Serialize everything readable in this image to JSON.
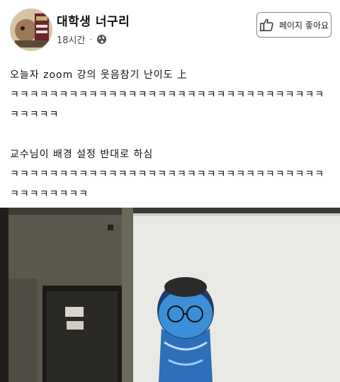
{
  "header": {
    "page_name": "대학생 너구리",
    "time": "18시간",
    "separator": "·",
    "like_page_label": "페이지 좋아요"
  },
  "post": {
    "line1": "오늘자 zoom 강의 웃음참기 난이도 上",
    "laugh1": "ㅋㅋㅋㅋㅋㅋㅋㅋㅋㅋㅋㅋㅋㅋㅋㅋㅋㅋㅋㅋㅋㅋㅋㅋㅋㅋㅋㅋㅋㅋㅋㅋㅋㅋㅋㅋㅋ",
    "line2": "교수님이 배경 설정 반대로 하심",
    "laugh2": "ㅋㅋㅋㅋㅋㅋㅋㅋㅋㅋㅋㅋㅋㅋㅋㅋㅋㅋㅋㅋㅋㅋㅋㅋㅋㅋㅋㅋㅋㅋㅋㅋㅋㅋㅋㅋㅋㅋㅋㅋ"
  },
  "icons": {
    "globe": "globe-icon",
    "like": "thumbs-up-icon"
  },
  "colors": {
    "video_bg": "#3b3a33",
    "whiteboard": "#e9e9e6",
    "face_mask_blue": "#3b8fd8"
  }
}
